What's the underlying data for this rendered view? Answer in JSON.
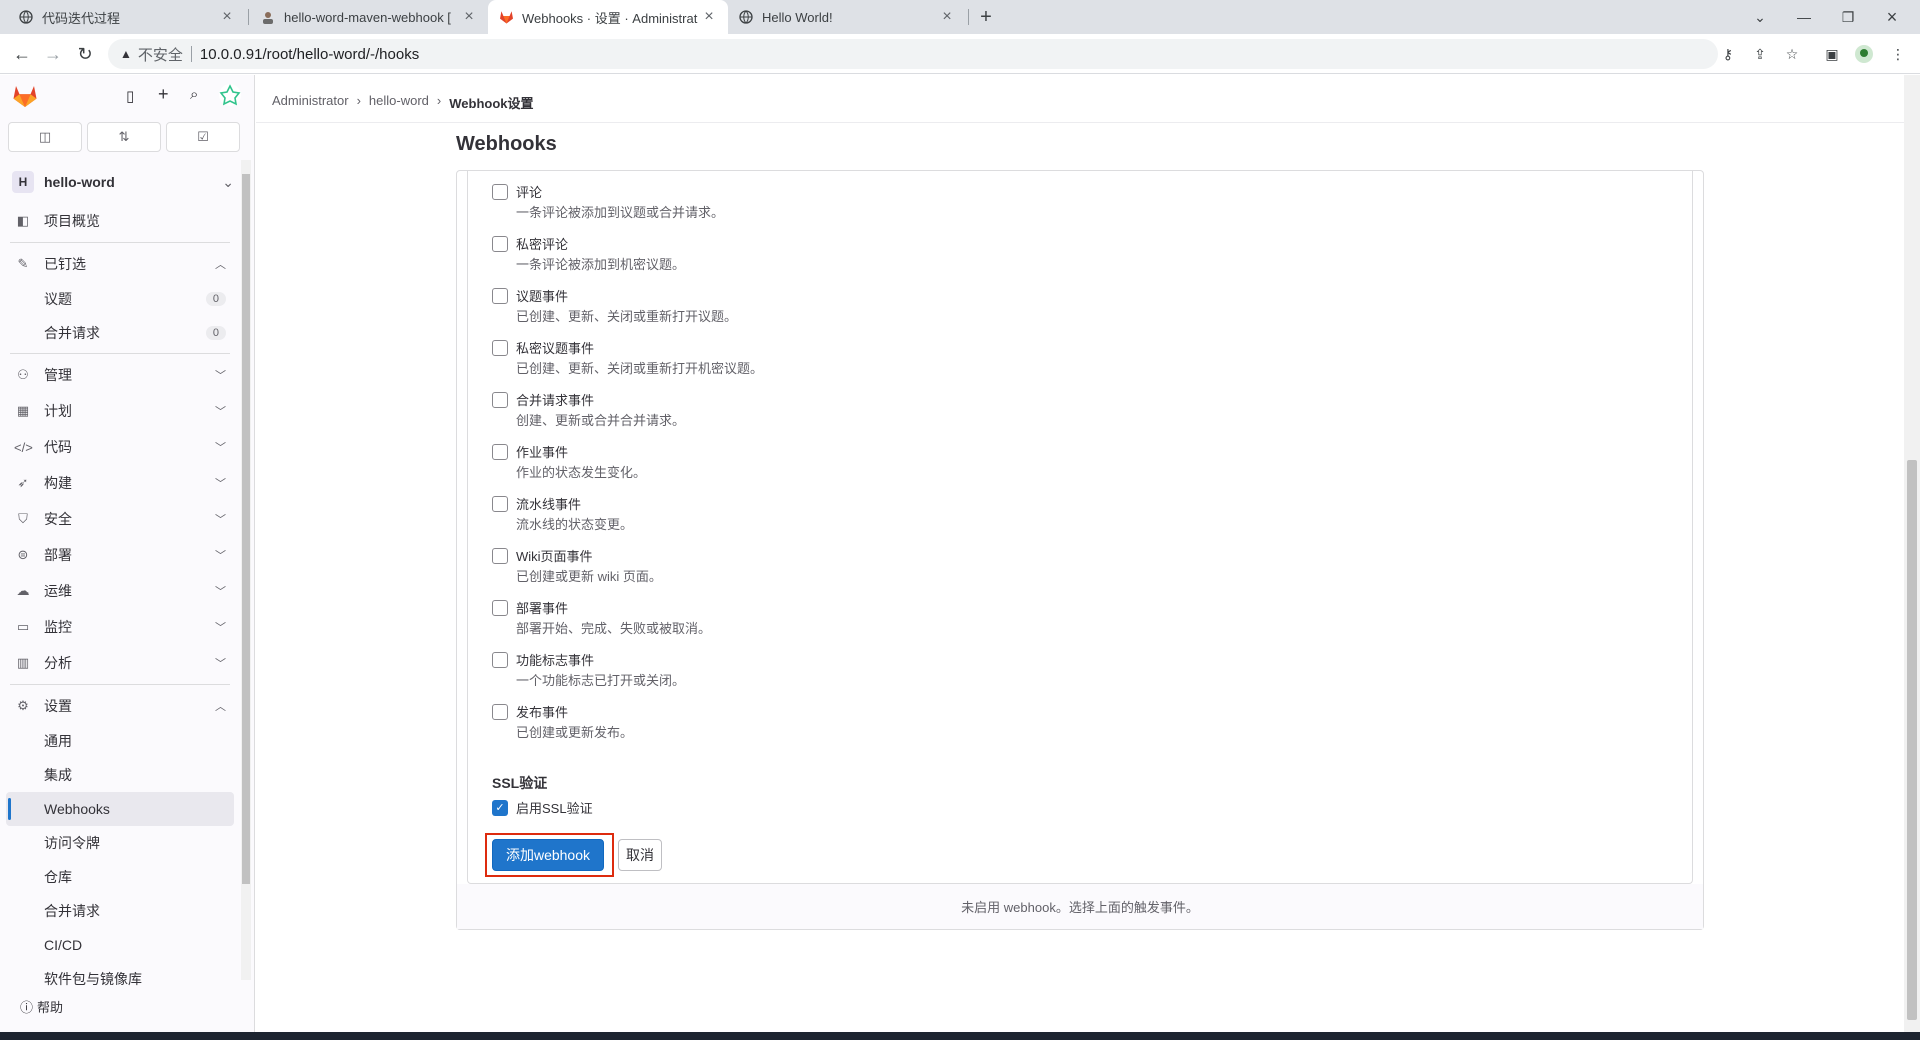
{
  "browser": {
    "tabs": [
      {
        "title": "代码迭代过程",
        "icon": "globe-icon"
      },
      {
        "title": "hello-word-maven-webhook [",
        "icon": "avatar-icon"
      },
      {
        "title": "Webhooks · 设置 · Administrat",
        "icon": "gitlab-icon"
      },
      {
        "title": "Hello World!",
        "icon": "globe-icon"
      }
    ],
    "new_tab": "+",
    "insecure_label": "不安全",
    "url": "10.0.0.91/root/hello-word/-/hooks"
  },
  "sidebar": {
    "tabs": [
      "issues-icon",
      "merge-requests-icon",
      "todo-icon"
    ],
    "project_initial": "H",
    "project_name": "hello-word",
    "items": [
      {
        "label": "项目概览",
        "icon": "project-icon"
      },
      {
        "label": "已钉选",
        "icon": "pin-icon"
      },
      {
        "label": "管理",
        "icon": "users-icon"
      },
      {
        "label": "计划",
        "icon": "calendar-icon"
      },
      {
        "label": "代码",
        "icon": "code-icon"
      },
      {
        "label": "构建",
        "icon": "rocket-icon"
      },
      {
        "label": "安全",
        "icon": "shield-icon"
      },
      {
        "label": "部署",
        "icon": "deploy-icon"
      },
      {
        "label": "运维",
        "icon": "cloud-icon"
      },
      {
        "label": "监控",
        "icon": "monitor-icon"
      },
      {
        "label": "分析",
        "icon": "chart-icon"
      },
      {
        "label": "设置",
        "icon": "gear-icon"
      }
    ],
    "pinned": [
      {
        "label": "议题",
        "count": "0"
      },
      {
        "label": "合并请求",
        "count": "0"
      }
    ],
    "settings": [
      "通用",
      "集成",
      "Webhooks",
      "访问令牌",
      "仓库",
      "合并请求",
      "CI/CD",
      "软件包与镜像库"
    ],
    "help": "帮助"
  },
  "breadcrumb": [
    "Administrator",
    "hello-word",
    "Webhook设置"
  ],
  "page_title": "Webhooks",
  "events": [
    {
      "label": "评论",
      "desc": "一条评论被添加到议题或合并请求。"
    },
    {
      "label": "私密评论",
      "desc": "一条评论被添加到机密议题。"
    },
    {
      "label": "议题事件",
      "desc": "已创建、更新、关闭或重新打开议题。"
    },
    {
      "label": "私密议题事件",
      "desc": "已创建、更新、关闭或重新打开机密议题。"
    },
    {
      "label": "合并请求事件",
      "desc": "创建、更新或合并合并请求。"
    },
    {
      "label": "作业事件",
      "desc": "作业的状态发生变化。"
    },
    {
      "label": "流水线事件",
      "desc": "流水线的状态变更。"
    },
    {
      "label": "Wiki页面事件",
      "desc": "已创建或更新 wiki 页面。"
    },
    {
      "label": "部署事件",
      "desc": "部署开始、完成、失败或被取消。"
    },
    {
      "label": "功能标志事件",
      "desc": "一个功能标志已打开或关闭。"
    },
    {
      "label": "发布事件",
      "desc": "已创建或更新发布。"
    }
  ],
  "ssl": {
    "title": "SSL验证",
    "label": "启用SSL验证",
    "checked": true
  },
  "buttons": {
    "add": "添加webhook",
    "cancel": "取消"
  },
  "footer_note": "未启用 webhook。选择上面的触发事件。"
}
